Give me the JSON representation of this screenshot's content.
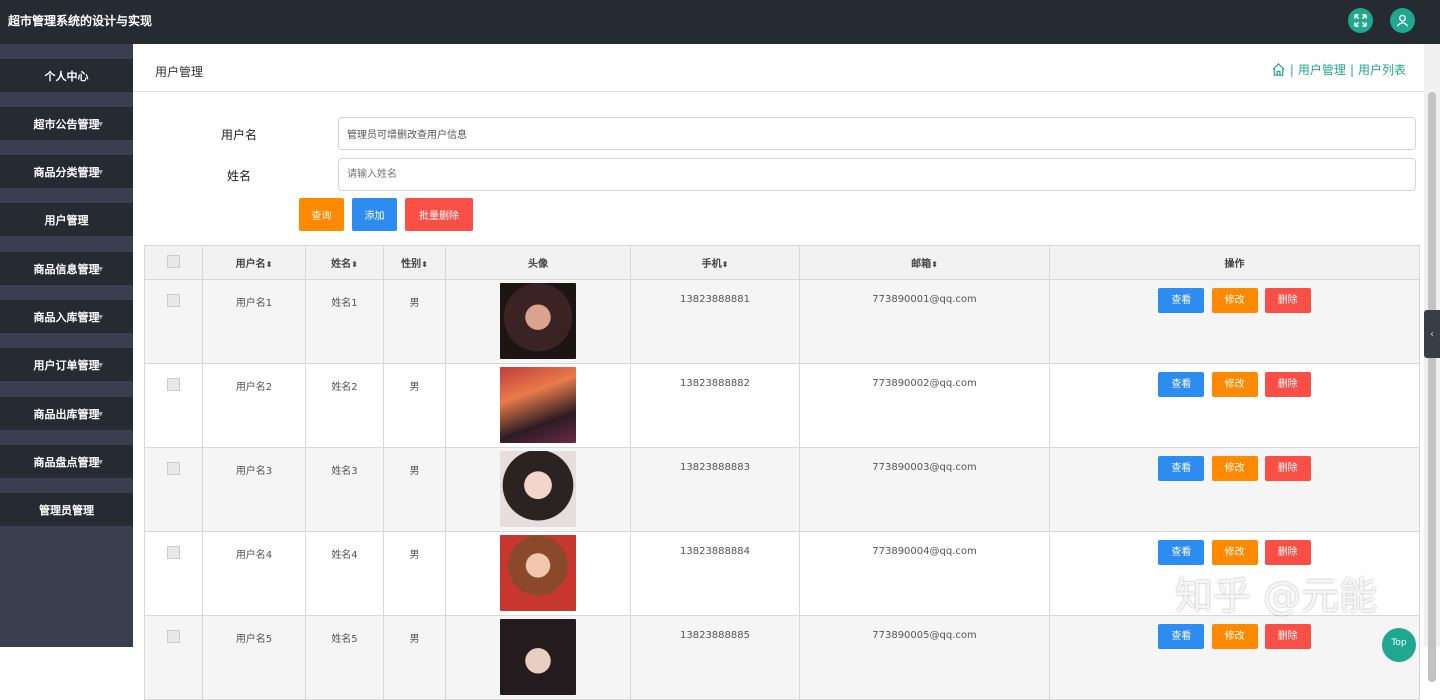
{
  "app": {
    "title": "超市管理系统的设计与实现"
  },
  "sidebar": {
    "items": [
      {
        "label": "个人中心"
      },
      {
        "label": "超市公告管理"
      },
      {
        "label": "商品分类管理"
      },
      {
        "label": "用户管理"
      },
      {
        "label": "商品信息管理"
      },
      {
        "label": "商品入库管理"
      },
      {
        "label": "用户订单管理"
      },
      {
        "label": "商品出库管理"
      },
      {
        "label": "商品盘点管理"
      },
      {
        "label": "管理员管理"
      }
    ]
  },
  "header": {
    "page_title": "用户管理",
    "crumb_sep": "|",
    "crumb_1": "用户管理",
    "crumb_2": "用户列表"
  },
  "search": {
    "username_label": "用户名",
    "username_value": "管理员可增删改查用户信息",
    "name_label": "姓名",
    "name_placeholder": "请输入姓名",
    "query_label": "查询",
    "add_label": "添加",
    "batch_delete_label": "批量删除"
  },
  "table": {
    "headers": {
      "username": "用户名",
      "name": "姓名",
      "gender": "性别",
      "avatar": "头像",
      "phone": "手机",
      "email": "邮箱",
      "actions": "操作"
    },
    "sort_glyph": "⬍",
    "rows": [
      {
        "username": "用户名1",
        "name": "姓名1",
        "gender": "男",
        "phone": "13823888881",
        "email": "773890001@qq.com"
      },
      {
        "username": "用户名2",
        "name": "姓名2",
        "gender": "男",
        "phone": "13823888882",
        "email": "773890002@qq.com"
      },
      {
        "username": "用户名3",
        "name": "姓名3",
        "gender": "男",
        "phone": "13823888883",
        "email": "773890003@qq.com"
      },
      {
        "username": "用户名4",
        "name": "姓名4",
        "gender": "男",
        "phone": "13823888884",
        "email": "773890004@qq.com"
      },
      {
        "username": "用户名5",
        "name": "姓名5",
        "gender": "男",
        "phone": "13823888885",
        "email": "773890005@qq.com"
      }
    ],
    "view_label": "查看",
    "edit_label": "修改",
    "delete_label": "删除"
  },
  "watermark": "知乎 @元能",
  "top_button": "Top",
  "colors": {
    "topbar": "#262a33",
    "accent": "#20a78f",
    "query": "#ff8a00",
    "add": "#2d8cf0",
    "delete": "#f94f47"
  }
}
